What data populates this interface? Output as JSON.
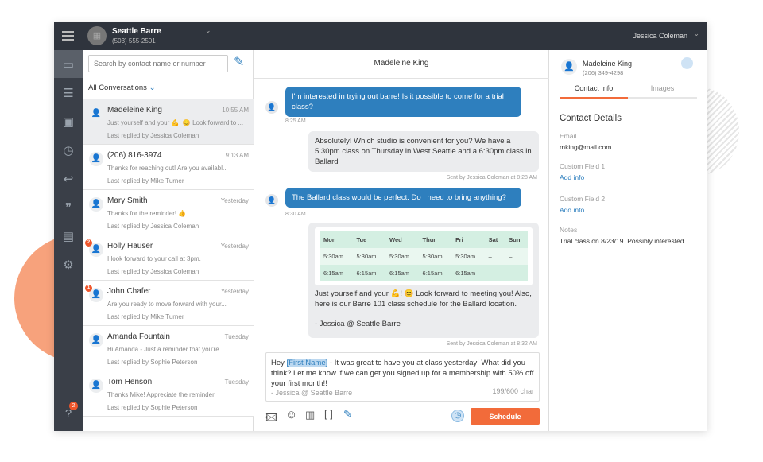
{
  "account": {
    "name": "Seattle Barre",
    "phone": "(503) 555-2501",
    "user": "Jessica Coleman"
  },
  "search": {
    "placeholder": "Search by contact name or number"
  },
  "filter": "All Conversations",
  "sidebar": {
    "items": [
      "chat-icon",
      "document-icon",
      "contacts-icon",
      "clock-icon",
      "reply-icon",
      "templates-icon",
      "clipboard-icon",
      "gear-icon"
    ],
    "help_badge": "2"
  },
  "conversations": [
    {
      "name": "Madeleine King",
      "time": "10:55 AM",
      "preview": "Just yourself and your 💪! 😊 Look forward to ...",
      "last": "Last replied by Jessica Coleman",
      "badge": ""
    },
    {
      "name": "(206) 816-3974",
      "time": "9:13 AM",
      "preview": "Thanks for reaching out! Are you availabl...",
      "last": "Last replied by Mike Turner",
      "badge": ""
    },
    {
      "name": "Mary Smith",
      "time": "Yesterday",
      "preview": "Thanks for the reminder! 👍",
      "last": "Last replied by Jessica Coleman",
      "badge": ""
    },
    {
      "name": "Holly Hauser",
      "time": "Yesterday",
      "preview": "I look forward to your call at 3pm.",
      "last": "Last replied by Jessica Coleman",
      "badge": "2"
    },
    {
      "name": "John Chafer",
      "time": "Yesterday",
      "preview": "Are you ready to move forward with your...",
      "last": "Last replied by Mike Turner",
      "badge": "1"
    },
    {
      "name": "Amanda Fountain",
      "time": "Tuesday",
      "preview": "Hi Amanda - Just a reminder that you're ...",
      "last": "Last replied by Sophie Peterson",
      "badge": ""
    },
    {
      "name": "Tom Henson",
      "time": "Tuesday",
      "preview": "Thanks Mike! Appreciate the reminder",
      "last": "Last replied by Sophie Peterson",
      "badge": ""
    }
  ],
  "chat": {
    "title": "Madeleine King",
    "messages": [
      {
        "text": "I'm interested in trying out barre! Is it possible to come for a trial class?",
        "meta": "8:25 AM"
      },
      {
        "text": "Absolutely! Which studio is convenient for you? We have a 5:30pm class on Thursday in West Seattle and a 6:30pm class in Ballard",
        "meta": "Sent by Jessica Coleman at 8:28 AM"
      },
      {
        "text": "The Ballard class would be perfect. Do I need to bring anything?",
        "meta": "8:30 AM"
      },
      {
        "text": "Just yourself and your 💪! 😊 Look forward to meeting you! Also, here is our Barre 101 class schedule for the Ballard location.",
        "signature": "- Jessica @ Seattle Barre",
        "meta": "Sent by Jessica Coleman at 8:32 AM"
      }
    ],
    "schedule": {
      "headers": [
        "Mon",
        "Tue",
        "Wed",
        "Thur",
        "Fri",
        "Sat",
        "Sun"
      ],
      "rows": [
        [
          "5:30am",
          "5:30am",
          "5:30am",
          "5:30am",
          "5:30am",
          "–",
          "–"
        ],
        [
          "6:15am",
          "6:15am",
          "6:15am",
          "6:15am",
          "6:15am",
          "–",
          "–"
        ]
      ]
    },
    "composer": {
      "pre": "Hey ",
      "token": "[First Name]",
      "post": " - It was great to have you at class yesterday! What did you think? Let me know if we can get you signed up for a membership with 50% off your first month!!",
      "signature": "- Jessica @ Seattle Barre",
      "count": "199/600 char",
      "schedule_label": "Schedule"
    }
  },
  "contact": {
    "name": "Madeleine King",
    "phone": "(206) 349-4298",
    "tabs": [
      "Contact Info",
      "Images"
    ],
    "heading": "Contact Details",
    "email_label": "Email",
    "email": "mking@mail.com",
    "cf1_label": "Custom Field 1",
    "cf2_label": "Custom Field 2",
    "add_info": "Add info",
    "notes_label": "Notes",
    "notes": "Trial class on 8/23/19. Possibly interested..."
  },
  "colors": {
    "accent": "#2e7fbe",
    "orange": "#f26b3a",
    "dark": "#2f343d"
  }
}
